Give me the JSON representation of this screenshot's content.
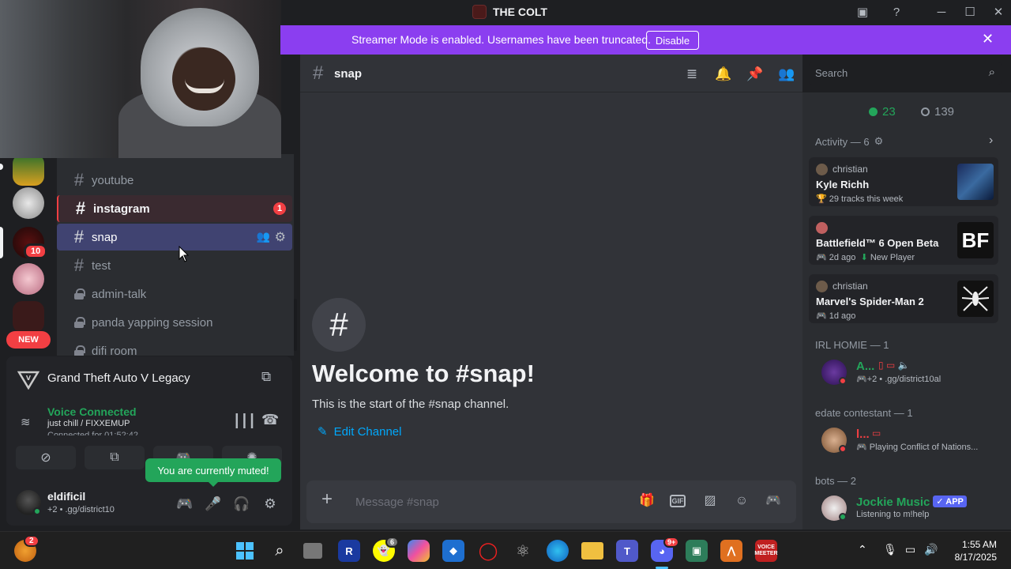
{
  "titlebar": {
    "server_title": "THE COLT"
  },
  "banner": {
    "text": "Streamer Mode is enabled. Usernames have been truncated.",
    "button": "Disable"
  },
  "guilds": {
    "badge_1": "10",
    "new_label": "NEW"
  },
  "channels": [
    {
      "name": "youtube",
      "type": "text",
      "state": "normal"
    },
    {
      "name": "instagram",
      "type": "text",
      "state": "unread",
      "badge": "1"
    },
    {
      "name": "snap",
      "type": "text",
      "state": "active"
    },
    {
      "name": "test",
      "type": "text",
      "state": "normal"
    },
    {
      "name": "admin-talk",
      "type": "locked",
      "state": "normal"
    },
    {
      "name": "panda yapping session",
      "type": "locked",
      "state": "normal"
    },
    {
      "name": "difi room",
      "type": "locked",
      "state": "normal"
    }
  ],
  "game": {
    "title": "Grand Theft Auto V Legacy"
  },
  "voice": {
    "status": "Voice Connected",
    "channel": "just chill / FIXXEMUP",
    "time": "Connected for 01:52:42"
  },
  "tooltip": {
    "text": "You are currently muted!"
  },
  "user": {
    "name": "eldificil",
    "sub": "+2 • .gg/district10"
  },
  "chat": {
    "channel_name": "snap",
    "welcome_title": "Welcome to #snap!",
    "welcome_sub": "This is the start of the #snap channel.",
    "edit_channel": "Edit Channel",
    "composer_placeholder": "Message #snap",
    "gif_label": "GIF"
  },
  "search": {
    "placeholder": "Search"
  },
  "members": {
    "online_count": "23",
    "offline_count": "139",
    "activity_header": "Activity — 6",
    "activities": [
      {
        "user": "christian",
        "title": "Kyle Richh",
        "sub": "29 tracks this week",
        "img_label": ""
      },
      {
        "user": "",
        "title": "Battlefield™ 6 Open Beta",
        "sub": "2d ago",
        "sub2": "New Player",
        "img_label": "BF"
      },
      {
        "user": "christian",
        "title": "Marvel's Spider-Man 2",
        "sub": "1d ago",
        "img_label": ""
      }
    ],
    "groups": [
      {
        "header": "IRL HOMIE — 1",
        "members": [
          {
            "name": "A...",
            "sub": "+2 • .gg/district10al",
            "color": "#23a55a"
          }
        ]
      },
      {
        "header": "edate contestant — 1",
        "members": [
          {
            "name": "l...",
            "sub": "Playing Conflict of Nations...",
            "color": "#f23f43"
          }
        ]
      },
      {
        "header": "bots — 2",
        "members": [
          {
            "name": "Jockie Music",
            "sub": "Listening to m!help",
            "color": "#23a55a",
            "tag": "APP"
          }
        ]
      }
    ]
  },
  "taskbar": {
    "badge_left": "2",
    "snap_badge": "6",
    "discord_badge": "9+",
    "clock_time": "1:55 AM",
    "clock_date": "8/17/2025",
    "voicemeeter": "VOICE MEETER"
  },
  "colors": {
    "accent": "#5865f2",
    "banner": "#8b3ef0",
    "online": "#23a55a",
    "danger": "#f23f43",
    "link": "#00a8fc"
  }
}
